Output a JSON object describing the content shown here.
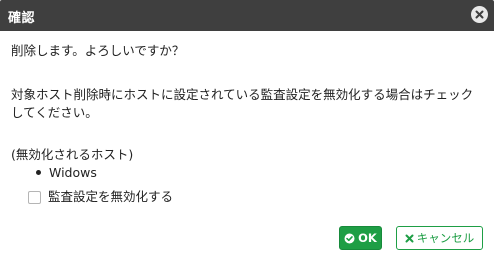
{
  "dialog": {
    "title": "確認",
    "close_icon": "close-icon"
  },
  "content": {
    "message_delete": "削除します。よろしいですか？",
    "message_monitor": "対象ホスト削除時にホストに設定されている監査設定を無効化する場合はチェックしてください。",
    "hosts_header": "(無効化されるホスト)",
    "hosts": [
      "Widows"
    ],
    "checkbox_label": "監査設定を無効化する",
    "checkbox_checked": false
  },
  "buttons": {
    "ok_label": "OK",
    "ok_icon": "check-circle-icon",
    "cancel_label": "キャンセル",
    "cancel_icon": "x-icon"
  },
  "colors": {
    "titlebar": "#3f3f3f",
    "accent": "#1e9e45"
  }
}
